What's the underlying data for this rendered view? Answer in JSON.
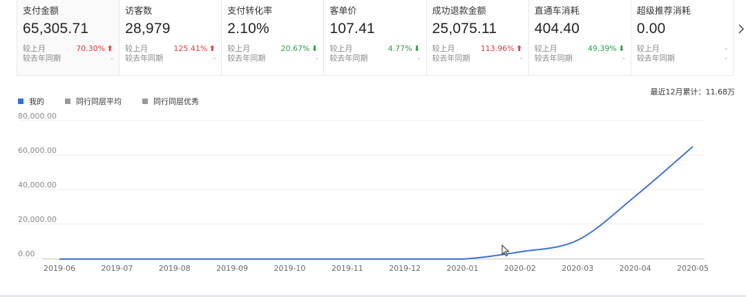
{
  "metrics": [
    {
      "title": "支付金额",
      "value": "65,305.71",
      "mom_label": "较上月",
      "mom_value": "70.30%",
      "mom_trend": "up",
      "yoy_label": "较去年同期",
      "yoy_value": "-"
    },
    {
      "title": "访客数",
      "value": "28,979",
      "mom_label": "较上月",
      "mom_value": "125.41%",
      "mom_trend": "up",
      "yoy_label": "较去年同期",
      "yoy_value": "-"
    },
    {
      "title": "支付转化率",
      "value": "2.10%",
      "mom_label": "较上月",
      "mom_value": "20.67%",
      "mom_trend": "down",
      "yoy_label": "较去年同期",
      "yoy_value": "-"
    },
    {
      "title": "客单价",
      "value": "107.41",
      "mom_label": "较上月",
      "mom_value": "4.77%",
      "mom_trend": "down",
      "yoy_label": "较去年同期",
      "yoy_value": "-"
    },
    {
      "title": "成功退款金额",
      "value": "25,075.11",
      "mom_label": "较上月",
      "mom_value": "113.96%",
      "mom_trend": "up",
      "yoy_label": "较去年同期",
      "yoy_value": "-"
    },
    {
      "title": "直通车消耗",
      "value": "404.40",
      "mom_label": "较上月",
      "mom_value": "49.39%",
      "mom_trend": "down",
      "yoy_label": "较去年同期",
      "yoy_value": "-"
    },
    {
      "title": "超级推荐消耗",
      "value": "0.00",
      "mom_label": "较上月",
      "mom_value": "-",
      "mom_trend": "none",
      "yoy_label": "较去年同期",
      "yoy_value": "-"
    }
  ],
  "legend": [
    {
      "label": "我的",
      "color": "#2f6fd6"
    },
    {
      "label": "同行同层平均",
      "color": "#999999"
    },
    {
      "label": "同行同层优秀",
      "color": "#999999"
    }
  ],
  "total_text": "最近12月累计：11.68万",
  "icons": {
    "next": "chevron-right-icon",
    "up": "arrow-up-icon",
    "down": "arrow-down-icon",
    "cursor": "mouse-cursor-icon"
  },
  "colors": {
    "line": "#3b6fd1",
    "up": "#e4393c",
    "down": "#2e9e4b",
    "grid": "#ececec"
  },
  "chart_data": {
    "type": "line",
    "x": [
      "2019-06",
      "2019-07",
      "2019-08",
      "2019-09",
      "2019-10",
      "2019-11",
      "2019-12",
      "2020-01",
      "2020-02",
      "2020-03",
      "2020-04",
      "2020-05"
    ],
    "series": [
      {
        "name": "我的",
        "values": [
          0,
          0,
          0,
          0,
          0,
          0,
          0,
          0,
          4200,
          11000,
          36500,
          65305.71
        ]
      }
    ],
    "yticks": [
      "0.00",
      "20,000.00",
      "40,000.00",
      "60,000.00",
      "80,000.00"
    ],
    "ylim": [
      0,
      80000
    ],
    "grid": true,
    "legend_position": "top-left"
  }
}
